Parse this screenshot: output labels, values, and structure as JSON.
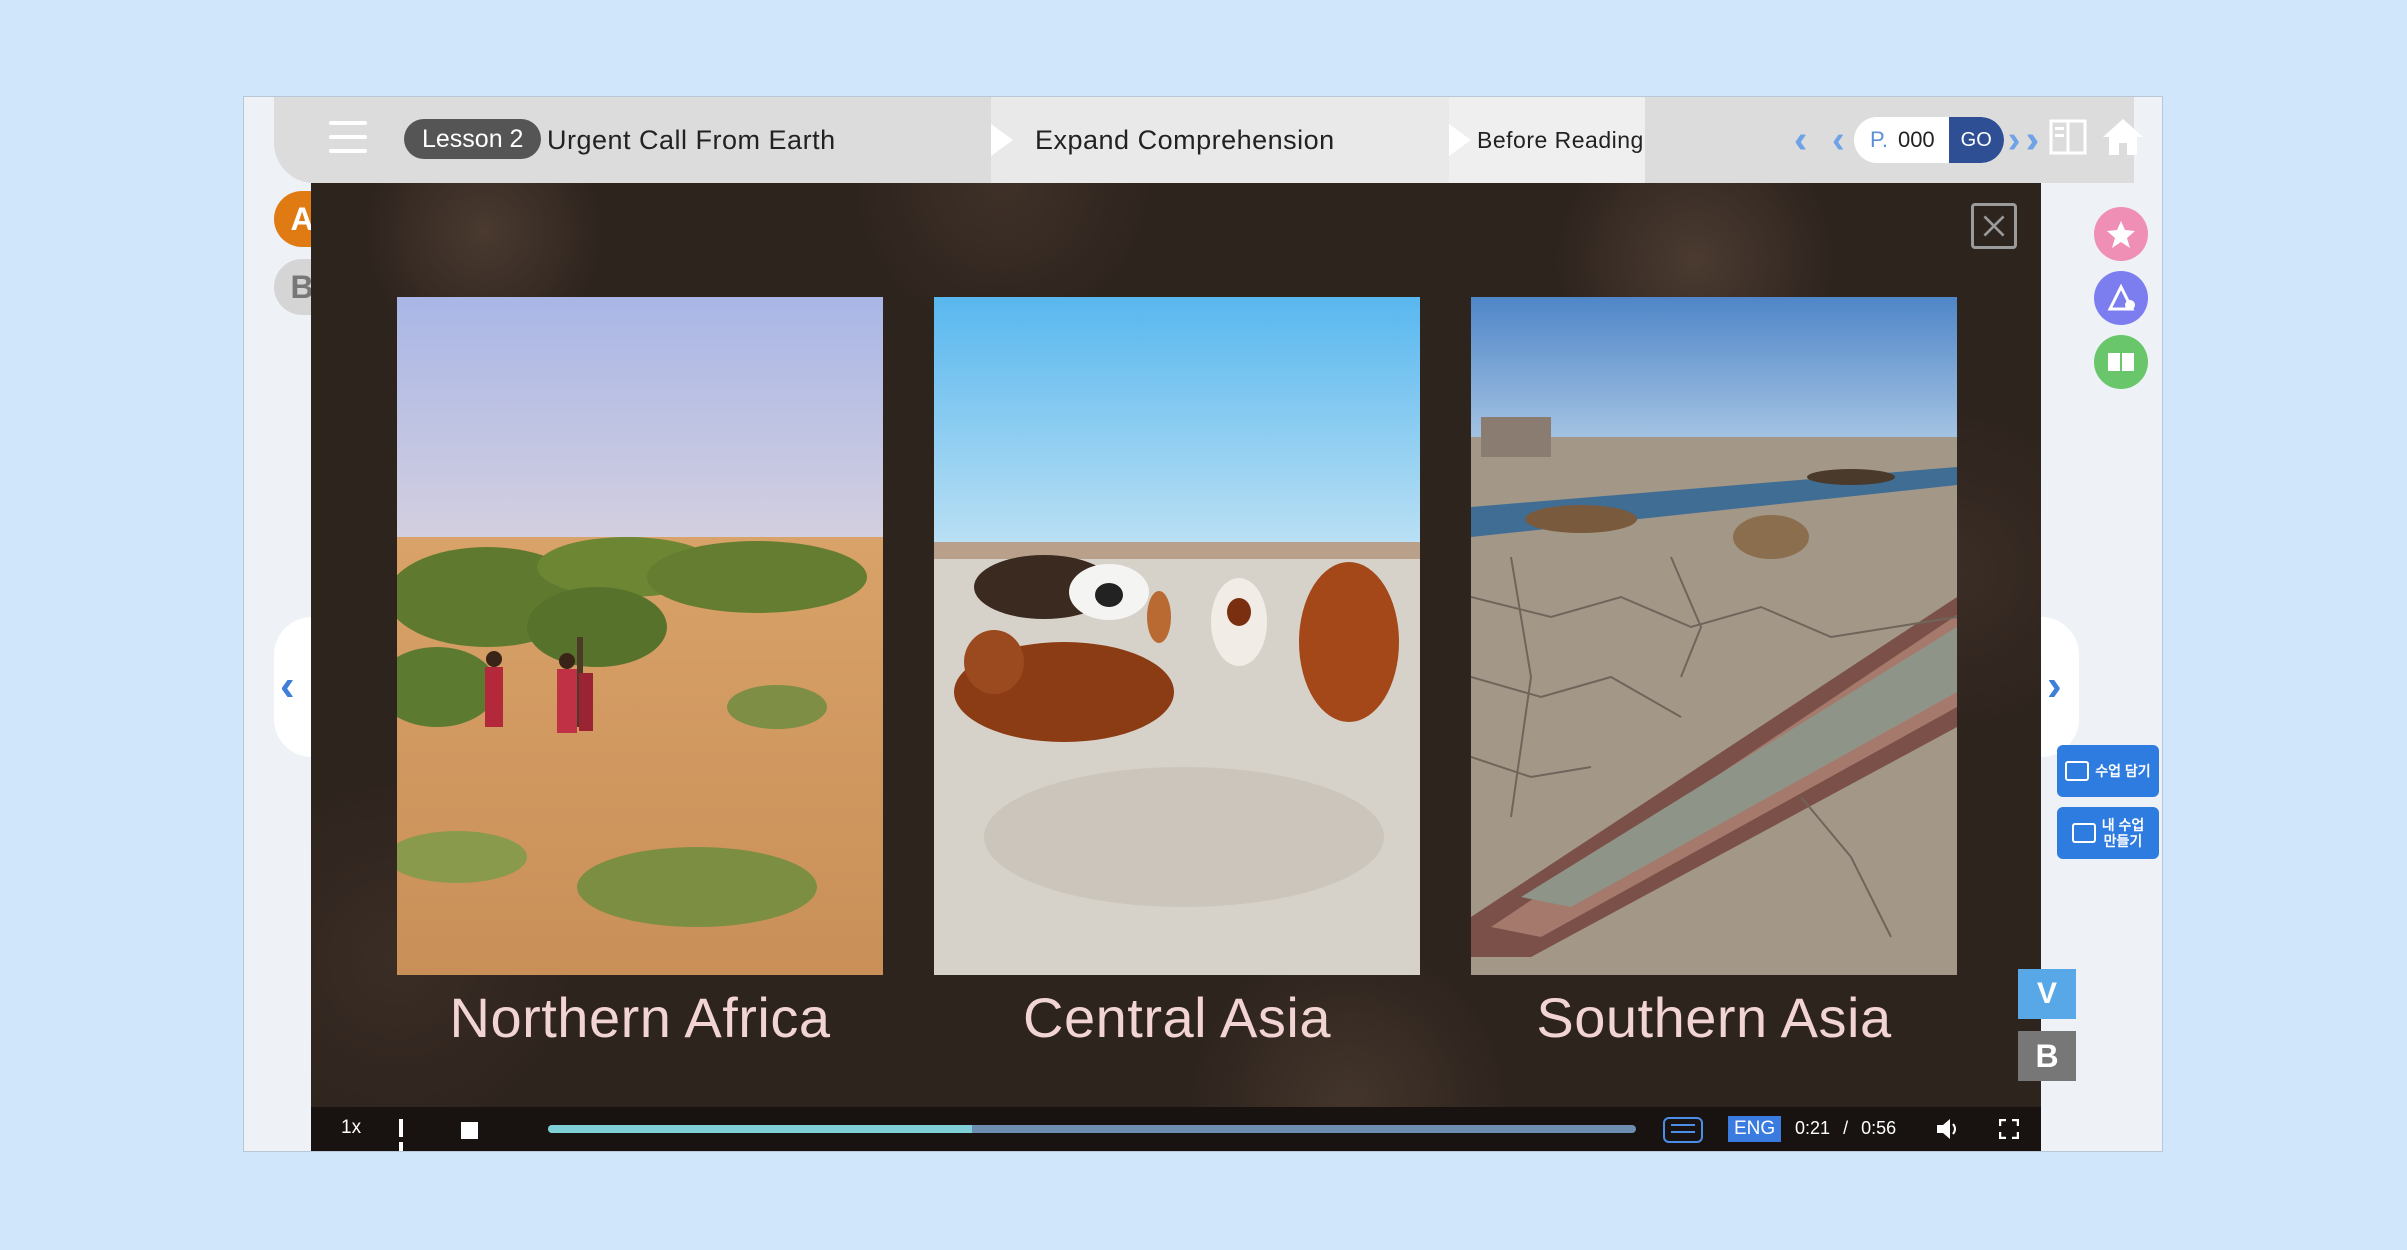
{
  "header": {
    "lesson_label": "Lesson 2",
    "lesson_title": "Urgent Call From Earth",
    "breadcrumbs": [
      "Expand Comprehension",
      "Before Reading"
    ],
    "page_prefix": "P.",
    "page_value": "000",
    "go_label": "GO"
  },
  "tabs": {
    "a": "A",
    "b": "B"
  },
  "slides": [
    {
      "caption": "Northern Africa"
    },
    {
      "caption": "Central Asia"
    },
    {
      "caption": "Southern Asia"
    }
  ],
  "player": {
    "speed": "1x",
    "progress": 0.39,
    "language": "ENG",
    "current_time": "0:21",
    "separator": "/",
    "duration": "0:56"
  },
  "right_panel": {
    "button1": "수업 담기",
    "button2_line1": "내 수업",
    "button2_line2": "만들기",
    "v_label": "V",
    "b_label": "B"
  },
  "icons": [
    "menu-icon",
    "book-icon",
    "home-icon",
    "close-icon",
    "star-icon",
    "tools-icon",
    "textbook-icon",
    "captions-icon",
    "volume-icon",
    "fullscreen-icon"
  ],
  "colors": {
    "accent": "#2f7ce0",
    "tab_a": "#e07a12",
    "go": "#2f4f94"
  }
}
